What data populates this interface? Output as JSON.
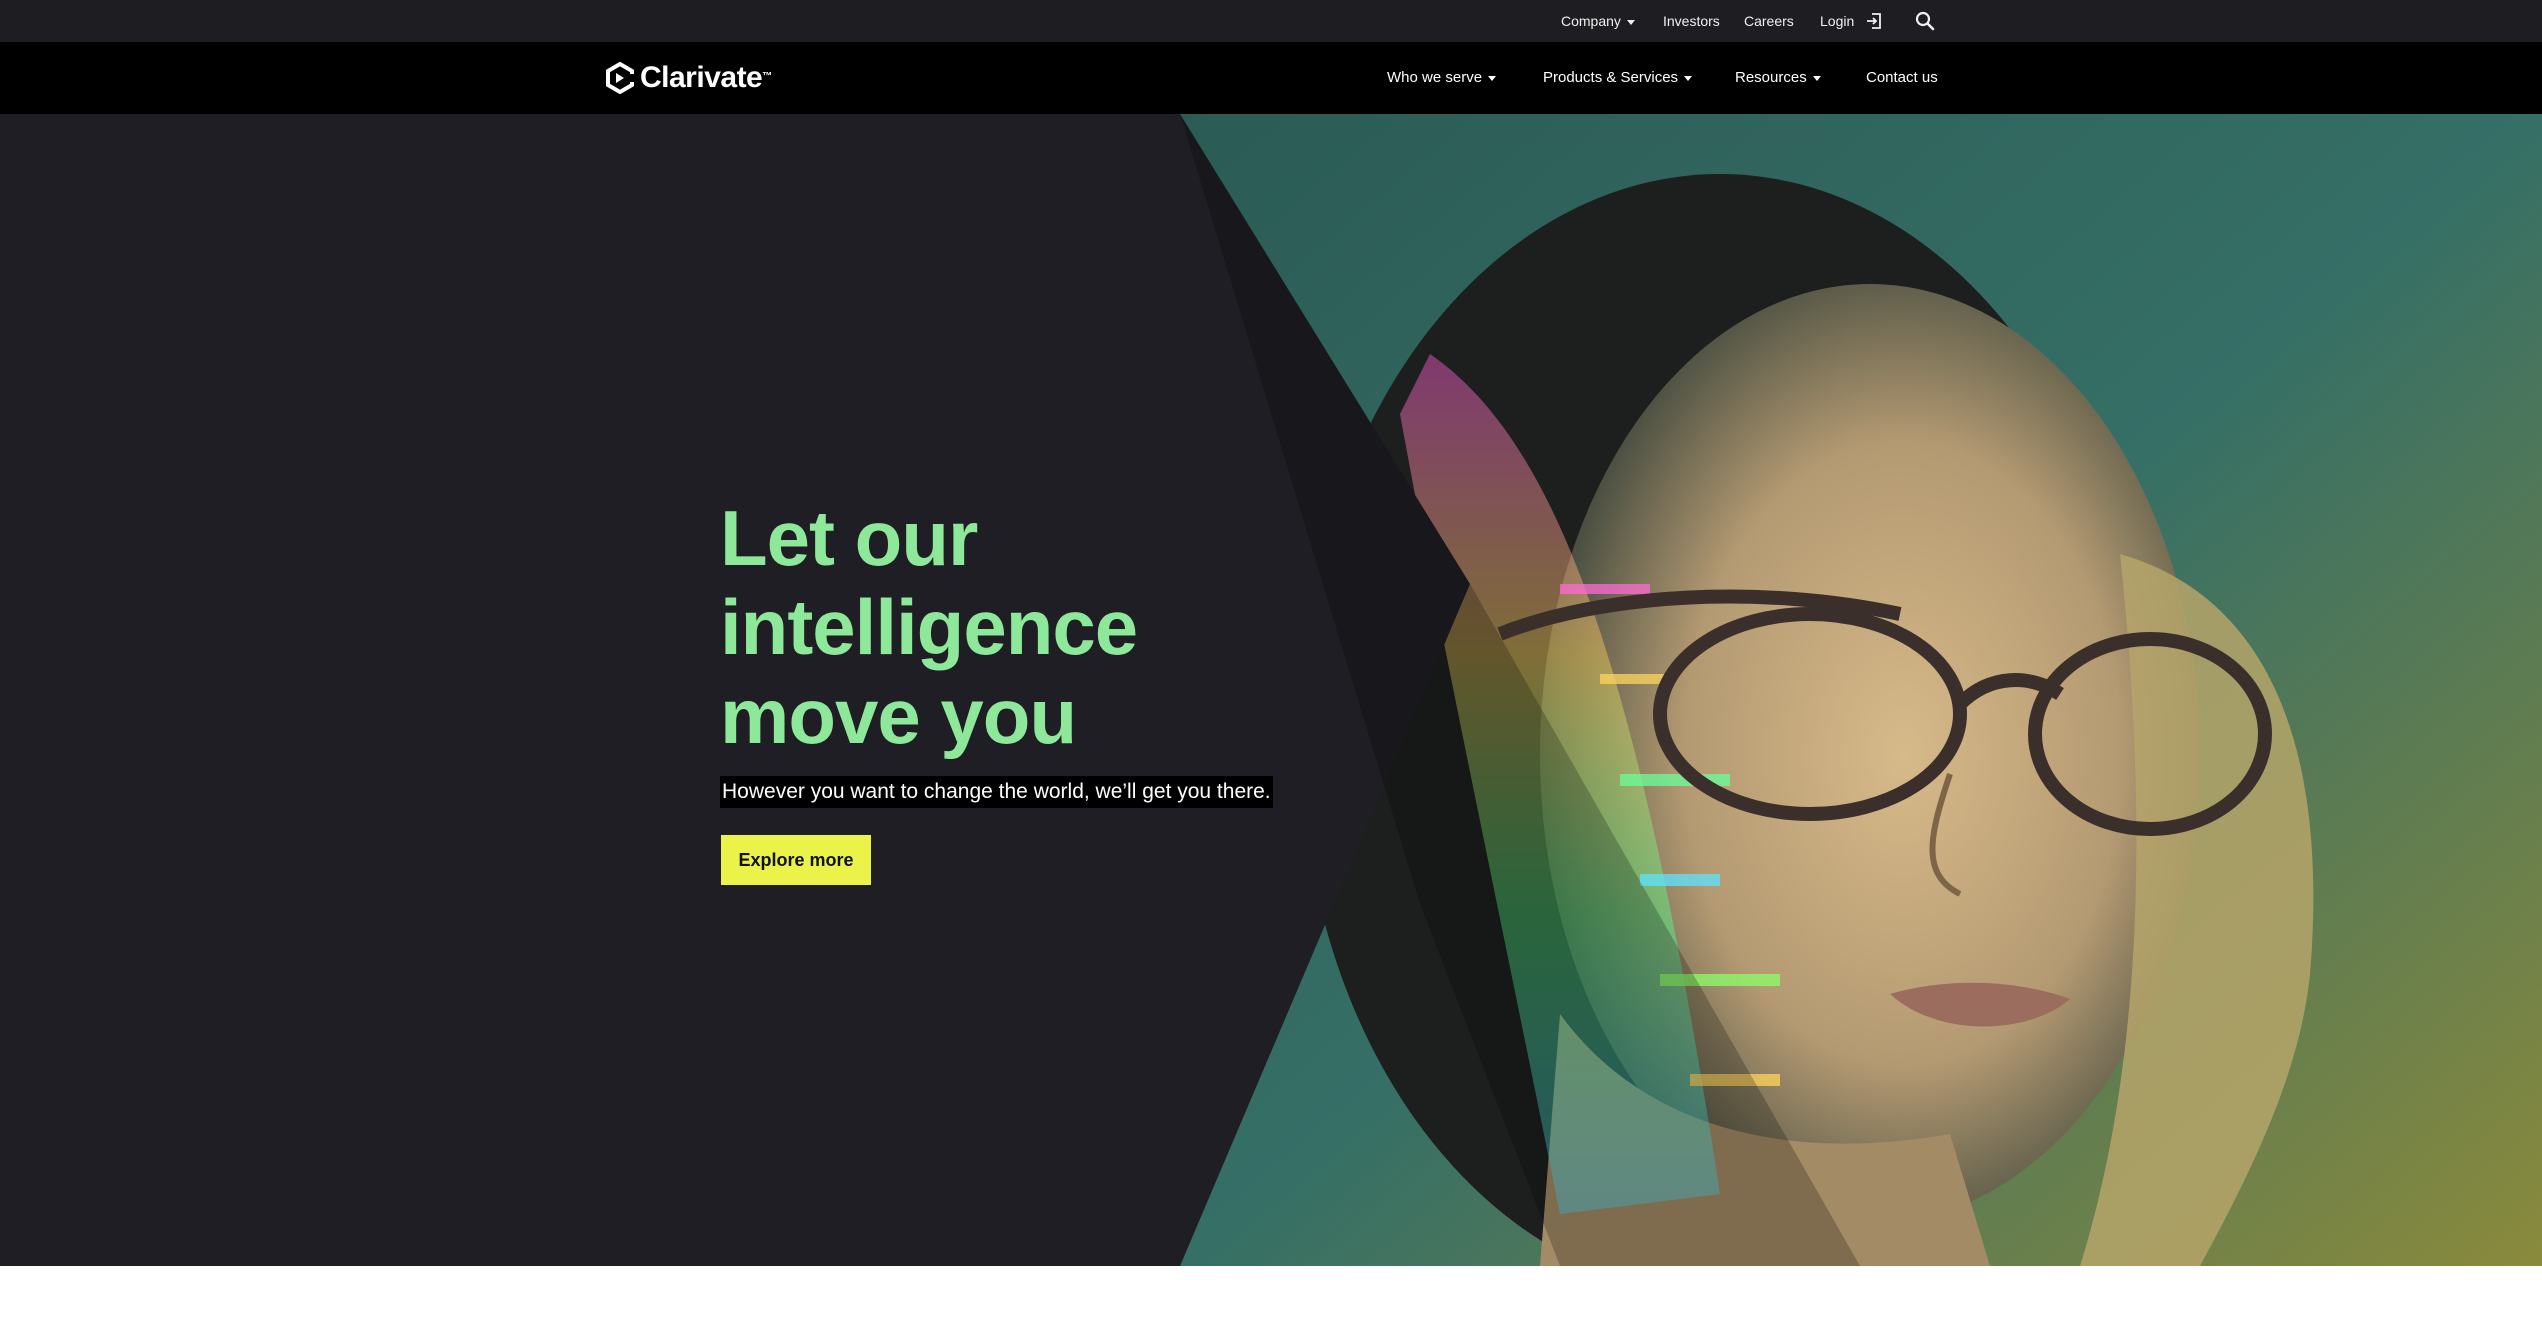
{
  "utility_nav": {
    "company": "Company",
    "investors": "Investors",
    "careers": "Careers",
    "login": "Login"
  },
  "brand": {
    "name": "Clarivate",
    "trademark": "™"
  },
  "main_nav": {
    "who_we_serve": "Who we serve",
    "products_services": "Products & Services",
    "resources": "Resources",
    "contact_us": "Contact us"
  },
  "hero": {
    "title_line1": "Let our",
    "title_line2": "intelligence",
    "title_line3": "move you",
    "subtitle": "However you want to change the world, we’ll get you there.",
    "cta_label": "Explore more"
  },
  "icons": {
    "login": "login-icon",
    "search": "search-icon",
    "logo": "clarivate-logo-mark",
    "dropdown": "chevron-down-icon"
  },
  "colors": {
    "utility_bar": "#1e1e22",
    "nav_bar": "#000000",
    "hero_bg": "#1f1e24",
    "title_green": "#8ee89a",
    "cta_yellow": "#ebf24a"
  }
}
